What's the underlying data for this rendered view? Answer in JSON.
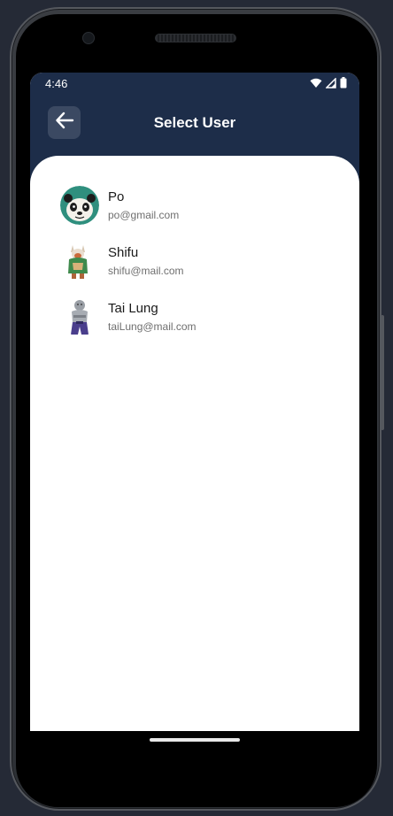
{
  "status_bar": {
    "time": "4:46",
    "icons": [
      "wifi-icon",
      "cell-signal-icon",
      "battery-icon"
    ]
  },
  "header": {
    "title": "Select User",
    "back_icon": "arrow-left-icon"
  },
  "users": [
    {
      "name": "Po",
      "email": "po@gmail.com",
      "avatar": "panda-avatar"
    },
    {
      "name": "Shifu",
      "email": "shifu@mail.com",
      "avatar": "red-panda-avatar"
    },
    {
      "name": "Tai Lung",
      "email": "taiLung@mail.com",
      "avatar": "snow-leopard-avatar"
    }
  ],
  "colors": {
    "header_bg": "#1d2d49",
    "back_button_bg": "#3b4962",
    "card_bg": "#ffffff",
    "name_text": "#1a1a1a",
    "email_text": "#6f6f6f"
  }
}
